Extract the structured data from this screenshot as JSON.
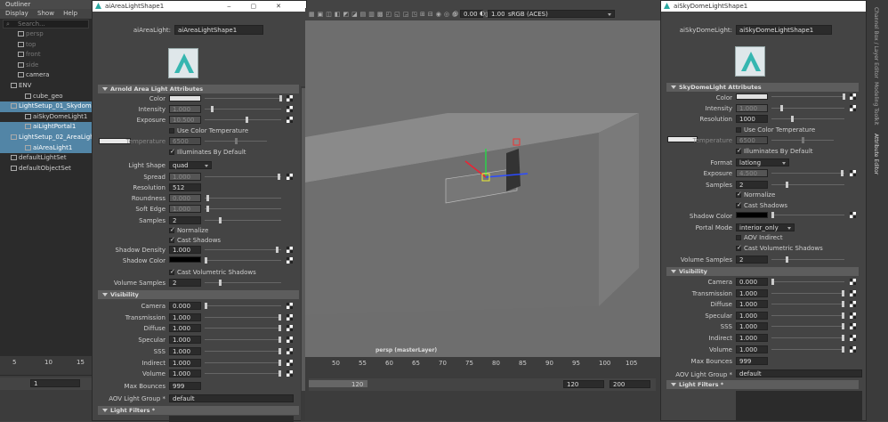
{
  "outliner": {
    "title": "Outliner",
    "menu": [
      "Display",
      "Show",
      "Help"
    ],
    "search": "Search...",
    "items": [
      {
        "label": "persp",
        "dim": true,
        "indent": 20
      },
      {
        "label": "top",
        "dim": true,
        "indent": 20
      },
      {
        "label": "front",
        "dim": true,
        "indent": 20
      },
      {
        "label": "side",
        "dim": true,
        "indent": 20
      },
      {
        "label": "camera",
        "dim": false,
        "indent": 20
      },
      {
        "label": "ENV",
        "dim": false,
        "indent": 12
      },
      {
        "label": "cube_geo",
        "dim": false,
        "indent": 28
      },
      {
        "label": "LightSetup_01_Skydome",
        "dim": false,
        "indent": 12,
        "sel": true
      },
      {
        "label": "aiSkyDomeLight1",
        "dim": false,
        "indent": 28
      },
      {
        "label": "aiLightPortal1",
        "dim": false,
        "indent": 28,
        "sel": true
      },
      {
        "label": "LightSetup_02_AreaLight",
        "dim": false,
        "indent": 12,
        "sel": true
      },
      {
        "label": "aiAreaLight1",
        "dim": false,
        "indent": 28,
        "sel": true
      },
      {
        "label": "defaultLightSet",
        "dim": false,
        "indent": 12
      },
      {
        "label": "defaultObjectSet",
        "dim": false,
        "indent": 12
      }
    ]
  },
  "timeline_left": {
    "ticks": [
      "5",
      "10",
      "15"
    ],
    "frame": "1"
  },
  "area": {
    "window_title": "aiAreaLightShape1",
    "name_label": "aiAreaLight:",
    "name_value": "aiAreaLightShape1",
    "section1": "Arnold Area Light Attributes",
    "color_label": "Color",
    "intensity_label": "Intensity",
    "intensity": "1.000",
    "exposure_label": "Exposure",
    "exposure": "10.500",
    "use_color_temp": "Use Color Temperature",
    "temperature_label": "Temperature",
    "temperature": "6500",
    "illuminates": "Illuminates By Default",
    "light_shape_label": "Light Shape",
    "light_shape": "quad",
    "spread_label": "Spread",
    "spread": "1.000",
    "resolution_label": "Resolution",
    "resolution": "512",
    "roundness_label": "Roundness",
    "roundness": "0.000",
    "soft_edge_label": "Soft Edge",
    "soft_edge": "1.000",
    "samples_label": "Samples",
    "samples": "2",
    "normalize": "Normalize",
    "cast_shadows": "Cast Shadows",
    "shadow_density_label": "Shadow Density",
    "shadow_density": "1.000",
    "shadow_color_label": "Shadow Color",
    "cast_vol_shadows": "Cast Volumetric Shadows",
    "vol_samples_label": "Volume Samples",
    "vol_samples": "2",
    "section2": "Visibility",
    "vis": [
      {
        "label": "Camera",
        "value": "0.000"
      },
      {
        "label": "Transmission",
        "value": "1.000"
      },
      {
        "label": "Diffuse",
        "value": "1.000"
      },
      {
        "label": "Specular",
        "value": "1.000"
      },
      {
        "label": "SSS",
        "value": "1.000"
      },
      {
        "label": "Indirect",
        "value": "1.000"
      },
      {
        "label": "Volume",
        "value": "1.000"
      }
    ],
    "max_bounces_label": "Max Bounces",
    "max_bounces": "999",
    "aov_label": "AOV Light Group *",
    "aov": "default",
    "section3": "Light Filters *"
  },
  "viewport": {
    "exposure": "0.00",
    "gamma": "1.00",
    "colorspace": "sRGB (ACES)",
    "label": "persp (masterLayer)",
    "ticks": [
      "50",
      "55",
      "60",
      "65",
      "70",
      "75",
      "80",
      "85",
      "90",
      "95",
      "100",
      "105"
    ],
    "range_mid": "120",
    "range_start": "120",
    "range_end": "200"
  },
  "sky": {
    "window_title": "aiSkyDomeLightShape1",
    "name_label": "aiSkyDomeLight:",
    "name_value": "aiSkyDomeLightShape1",
    "section1": "SkyDomeLight Attributes",
    "color_label": "Color",
    "intensity_label": "Intensity",
    "intensity": "1.000",
    "resolution_label": "Resolution",
    "resolution": "1000",
    "use_color_temp": "Use Color Temperature",
    "temperature_label": "Temperature",
    "temperature": "6500",
    "illuminates": "Illuminates By Default",
    "format_label": "Format",
    "format": "latlong",
    "exposure_label": "Exposure",
    "exposure": "4.500",
    "samples_label": "Samples",
    "samples": "2",
    "normalize": "Normalize",
    "cast_shadows": "Cast Shadows",
    "shadow_color_label": "Shadow Color",
    "portal_mode_label": "Portal Mode",
    "portal_mode": "interior_only",
    "aov_indirect": "AOV Indirect",
    "cast_vol_shadows": "Cast Volumetric Shadows",
    "vol_samples_label": "Volume Samples",
    "vol_samples": "2",
    "section2": "Visibility",
    "vis": [
      {
        "label": "Camera",
        "value": "0.000"
      },
      {
        "label": "Transmission",
        "value": "1.000"
      },
      {
        "label": "Diffuse",
        "value": "1.000"
      },
      {
        "label": "Specular",
        "value": "1.000"
      },
      {
        "label": "SSS",
        "value": "1.000"
      },
      {
        "label": "Indirect",
        "value": "1.000"
      },
      {
        "label": "Volume",
        "value": "1.000"
      }
    ],
    "max_bounces_label": "Max Bounces",
    "max_bounces": "999",
    "aov_label": "AOV Light Group *",
    "aov": "default",
    "section3": "Light Filters *"
  },
  "side_tabs": [
    "Channel Box / Layer Editor",
    "Modeling Toolkit",
    "Attribute Editor"
  ]
}
